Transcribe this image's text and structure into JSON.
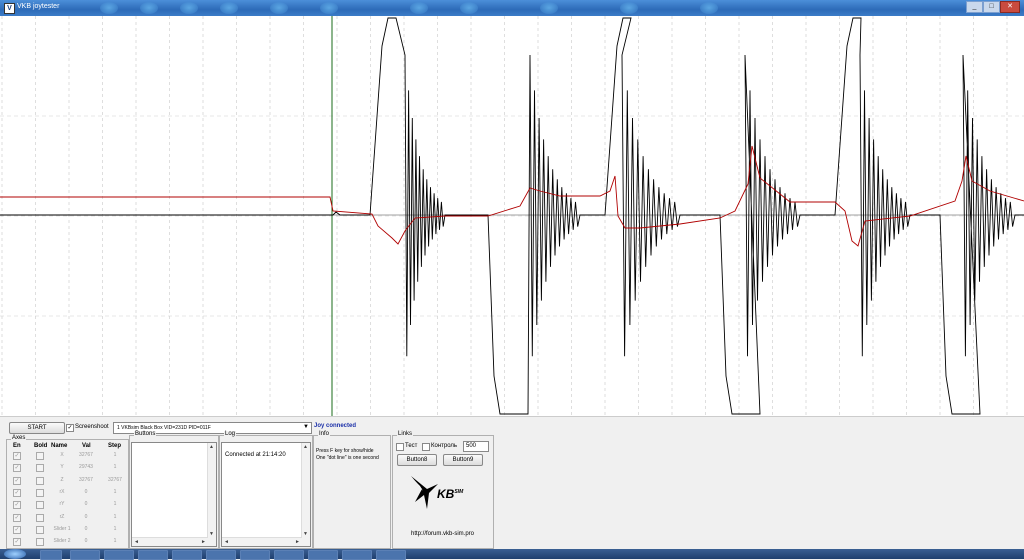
{
  "window": {
    "title": "VKB joytester",
    "icon_letter": "V"
  },
  "toolbar": {
    "start_label": "START",
    "screenshot_label": "Screenshoot",
    "screenshot_checked": true,
    "device_selected": "1 VKBsim Black Box  VID=231D PID=011F",
    "status_text": "Joy connected"
  },
  "axes": {
    "title": "Axes",
    "headers": {
      "en": "En",
      "bold": "Bold",
      "name": "Name",
      "val": "Val",
      "step": "Step"
    },
    "rows": [
      {
        "name": "X",
        "val": "32767",
        "step": "1",
        "enabled": true,
        "bold": false
      },
      {
        "name": "Y",
        "val": "29743",
        "step": "1",
        "enabled": true,
        "bold": false
      },
      {
        "name": "Z",
        "val": "32767",
        "step": "32767",
        "enabled": true,
        "bold": false
      },
      {
        "name": "rX",
        "val": "0",
        "step": "1",
        "enabled": true,
        "bold": false
      },
      {
        "name": "rY",
        "val": "0",
        "step": "1",
        "enabled": true,
        "bold": false
      },
      {
        "name": "rZ",
        "val": "0",
        "step": "1",
        "enabled": true,
        "bold": false
      },
      {
        "name": "Slider 1",
        "val": "0",
        "step": "1",
        "enabled": true,
        "bold": false
      },
      {
        "name": "Slider 2",
        "val": "0",
        "step": "1",
        "enabled": true,
        "bold": false
      }
    ]
  },
  "buttons_group": {
    "title": "Buttons"
  },
  "log": {
    "title": "Log",
    "lines": [
      "Connected at 21:14:20"
    ]
  },
  "info": {
    "title": "Info",
    "line1": "Press F key for show/hide",
    "line2": "One \"dot line\" is one second"
  },
  "links": {
    "title": "Links",
    "test_label": "Тест",
    "control_label": "Контроль",
    "number_value": "500",
    "button8_label": "Button8",
    "button9_label": "Button9",
    "logo_text": "KB",
    "logo_sup": "SIM",
    "url": "http://forum.vkb-sim.pro"
  },
  "colors": {
    "black_trace": "#000000",
    "red_trace": "#b00000",
    "gray_trace": "#909090",
    "green_marker": "#1a6b1a",
    "status_blue": "#1a2fa8"
  }
}
